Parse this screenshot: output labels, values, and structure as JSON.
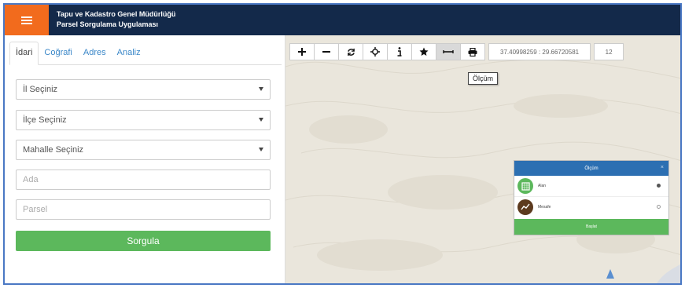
{
  "header": {
    "title_line1": "Tapu ve Kadastro Genel Müdürlüğü",
    "title_line2": "Parsel Sorgulama Uygulaması",
    "menu_icon": "hamburger-icon",
    "background": "#13294a",
    "accent": "#f26b1d"
  },
  "tabs": [
    {
      "label": "İdari",
      "active": true
    },
    {
      "label": "Coğrafi"
    },
    {
      "label": "Adres"
    },
    {
      "label": "Analiz"
    }
  ],
  "form": {
    "il": "İl Seçiniz",
    "ilce": "İlçe Seçiniz",
    "mahalle": "Mahalle Seçiniz",
    "ada_placeholder": "Ada",
    "parsel_placeholder": "Parsel",
    "query_label": "Sorgula"
  },
  "toolbar": {
    "tools": [
      "plus-icon",
      "minus-icon",
      "refresh-icon",
      "locate-icon",
      "info-icon",
      "star-icon",
      "measure-icon",
      "print-icon"
    ],
    "coordinates": "37.40998259 : 29.66720581",
    "zoom": "12",
    "tooltip": "Ölçüm"
  },
  "measure_panel": {
    "title": "Ölçüm",
    "close": "×",
    "options": [
      {
        "label": "Alan",
        "icon": "area-icon",
        "selected": true
      },
      {
        "label": "Mesafe",
        "icon": "distance-icon",
        "selected": false
      }
    ],
    "footer": "Başlat"
  },
  "colors": {
    "success": "#5cb85c",
    "link": "#3a87c8",
    "panel_header": "#2c6fb2",
    "map_base": "#eae6dc"
  }
}
